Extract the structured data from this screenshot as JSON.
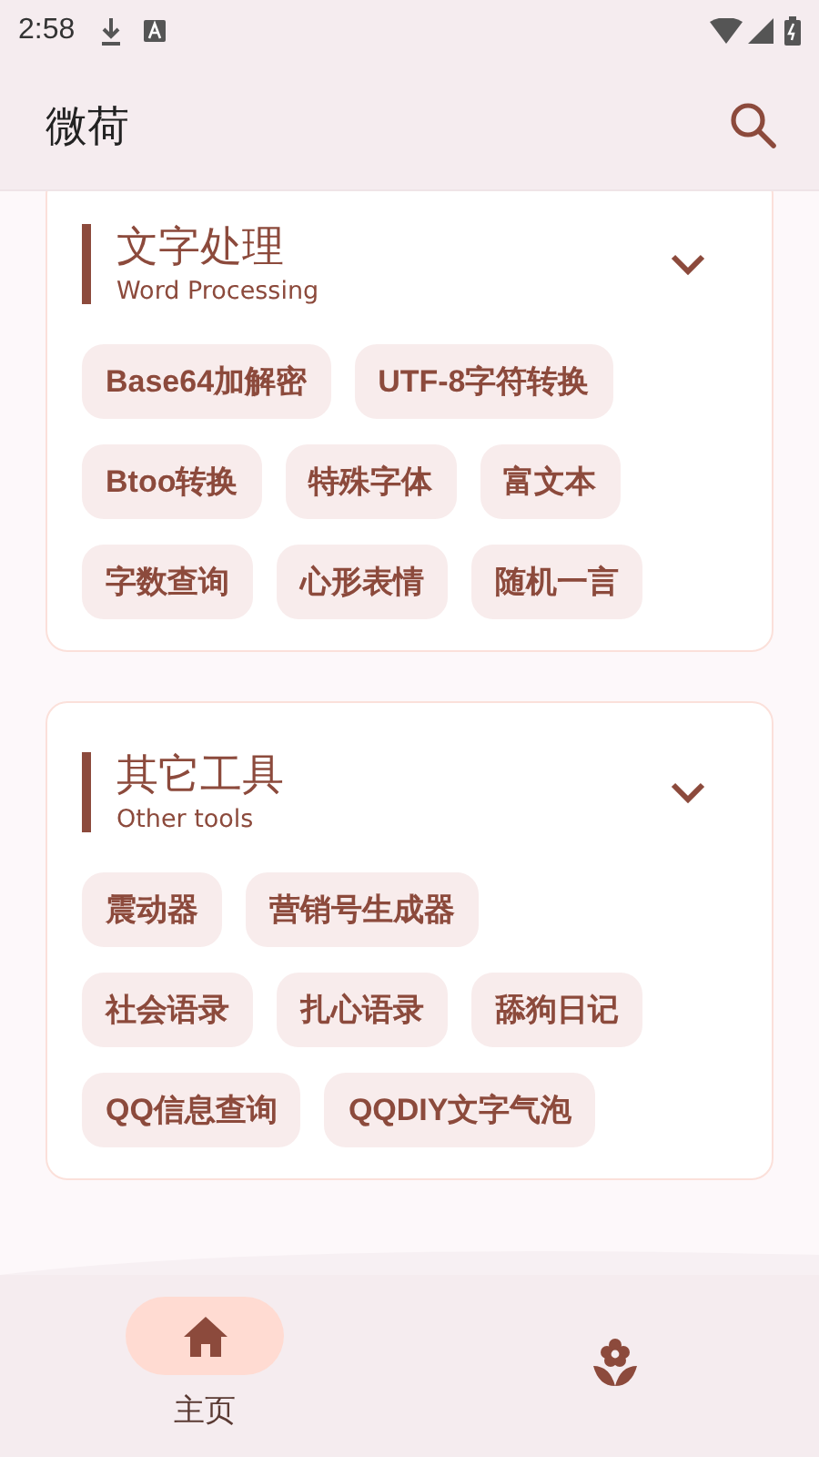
{
  "status_bar": {
    "time": "2:58"
  },
  "app_bar": {
    "title": "微荷"
  },
  "sections": [
    {
      "title": "文字处理",
      "subtitle": "Word Processing",
      "expanded": true,
      "tool_rows": [
        [
          "Base64加解密",
          "UTF-8字符转换"
        ],
        [
          "Btoo转换",
          "特殊字体",
          "富文本"
        ],
        [
          "字数查询",
          "心形表情",
          "随机一言"
        ]
      ]
    },
    {
      "title": "其它工具",
      "subtitle": "Other tools",
      "expanded": true,
      "tool_rows": [
        [
          "震动器",
          "营销号生成器"
        ],
        [
          "社会语录",
          "扎心语录",
          "舔狗日记"
        ],
        [
          "QQ信息查询",
          "QQDIY文字气泡"
        ]
      ]
    }
  ],
  "bottom_nav": [
    {
      "kind": "home",
      "label": "主页",
      "selected": true
    },
    {
      "kind": "flower",
      "selected": false
    }
  ]
}
